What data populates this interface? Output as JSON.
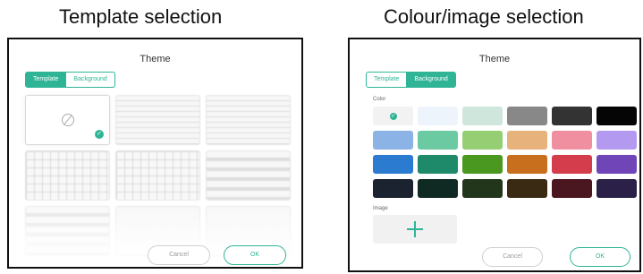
{
  "captions": {
    "left": "Template selection",
    "right": "Colour/image selection"
  },
  "dialog": {
    "title": "Theme",
    "tabs": [
      "Template",
      "Background"
    ],
    "cancel_label": "Cancel",
    "ok_label": "OK"
  },
  "template_panel": {
    "active_tab": "Template",
    "templates": [
      {
        "kind": "none",
        "icon": "no-template-icon",
        "selected": true
      },
      {
        "kind": "lines"
      },
      {
        "kind": "lines"
      },
      {
        "kind": "grid"
      },
      {
        "kind": "grid"
      },
      {
        "kind": "bars"
      },
      {
        "kind": "bars"
      },
      {
        "kind": "furn"
      },
      {
        "kind": "furn"
      }
    ]
  },
  "color_panel": {
    "active_tab": "Background",
    "color_label": "Color",
    "image_label": "Image",
    "swatches": [
      "#f2f2f2",
      "#eef4fb",
      "#cfe6dd",
      "#888888",
      "#333333",
      "#050505",
      "#8bb3e6",
      "#6ccaa3",
      "#96cf73",
      "#e8b27c",
      "#f08fa0",
      "#b39af0",
      "#2b7bd0",
      "#1f8a6a",
      "#4a981f",
      "#c86f1e",
      "#d43e4c",
      "#6f45b8",
      "#1b2230",
      "#0f2a22",
      "#22361b",
      "#3a2a14",
      "#4a1620",
      "#2a2048"
    ],
    "selected_swatch": 0
  },
  "accent": "#2fb596"
}
